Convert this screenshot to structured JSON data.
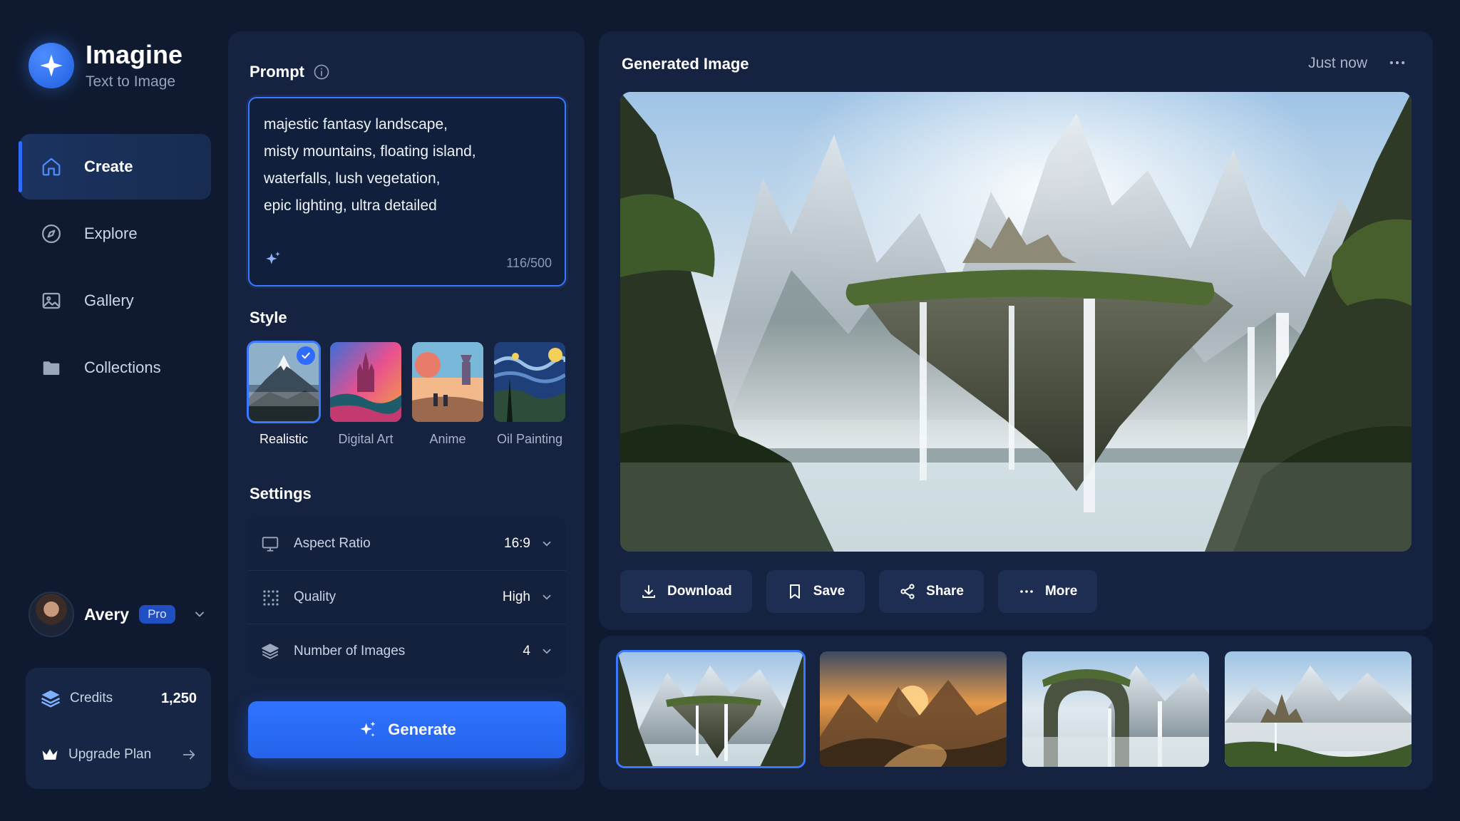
{
  "app": {
    "title": "Imagine",
    "subtitle": "Text to Image"
  },
  "sidebar": {
    "items": [
      {
        "label": "Create",
        "icon": "home-icon",
        "active": true
      },
      {
        "label": "Explore",
        "icon": "compass-icon",
        "active": false
      },
      {
        "label": "Gallery",
        "icon": "image-icon",
        "active": false
      },
      {
        "label": "Collections",
        "icon": "folder-icon",
        "active": false
      }
    ]
  },
  "user": {
    "name": "Avery",
    "plan": "Pro"
  },
  "credits": {
    "label": "Credits",
    "value": "1,250",
    "upgrade_label": "Upgrade Plan"
  },
  "prompt": {
    "title": "Prompt",
    "text": "majestic fantasy landscape,\nmisty mountains, floating island,\nwaterfalls, lush vegetation,\nepic lighting, ultra detailed",
    "count": "116/500"
  },
  "style": {
    "title": "Style",
    "options": [
      {
        "label": "Realistic",
        "selected": true
      },
      {
        "label": "Digital Art",
        "selected": false
      },
      {
        "label": "Anime",
        "selected": false
      },
      {
        "label": "Oil Painting",
        "selected": false
      }
    ]
  },
  "settings": {
    "title": "Settings",
    "rows": [
      {
        "label": "Aspect Ratio",
        "value": "16:9",
        "icon": "monitor-icon"
      },
      {
        "label": "Quality",
        "value": "High",
        "icon": "grid-dots-icon"
      },
      {
        "label": "Number of Images",
        "value": "4",
        "icon": "layers-icon"
      }
    ]
  },
  "generate_label": "Generate",
  "result": {
    "title": "Generated Image",
    "time": "Just now",
    "actions": [
      {
        "label": "Download",
        "icon": "download-icon"
      },
      {
        "label": "Save",
        "icon": "bookmark-icon"
      },
      {
        "label": "Share",
        "icon": "share-icon"
      },
      {
        "label": "More",
        "icon": "more-horizontal-icon"
      }
    ]
  },
  "colors": {
    "accent": "#2f6bff",
    "background": "#0f1a30",
    "panel": "#152340"
  }
}
